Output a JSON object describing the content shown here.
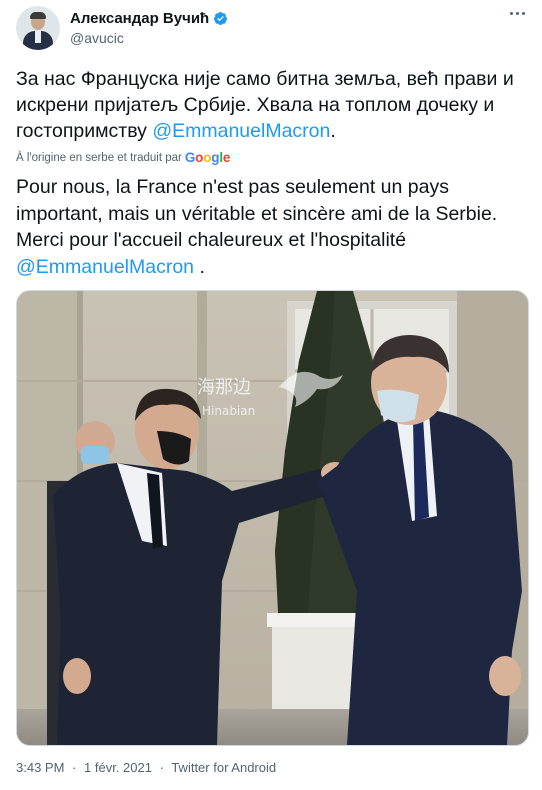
{
  "author": {
    "name": "Александар Вучић",
    "handle": "@avucic"
  },
  "tweet": {
    "text_original_main": "За нас Француска није само битна земља, већ прави и искрени пријатељ Србије. Хвала на топлом дочеку и гостопримству ",
    "text_original_mention": "@EmmanuelMacron",
    "text_original_end": ".",
    "translation_note": "À l'origine en serbe et traduit par",
    "translation_provider": "Google",
    "text_translated_main": "Pour nous, la France n'est pas seulement un pays important, mais un véritable et sincère ami de la Serbie. Merci pour l'accueil chaleureux et l'hospitalité ",
    "text_translated_mention": "@EmmanuelMacron",
    "text_translated_end": " ."
  },
  "photo": {
    "watermark_cn": "海那边",
    "watermark_en": "Hinabian"
  },
  "meta": {
    "time": "3:43 PM",
    "separator1": "·",
    "date": "1 févr. 2021",
    "separator2": "·",
    "source": "Twitter for Android"
  },
  "colors": {
    "accent": "#1d9bf0",
    "secondary_text": "#536471"
  }
}
